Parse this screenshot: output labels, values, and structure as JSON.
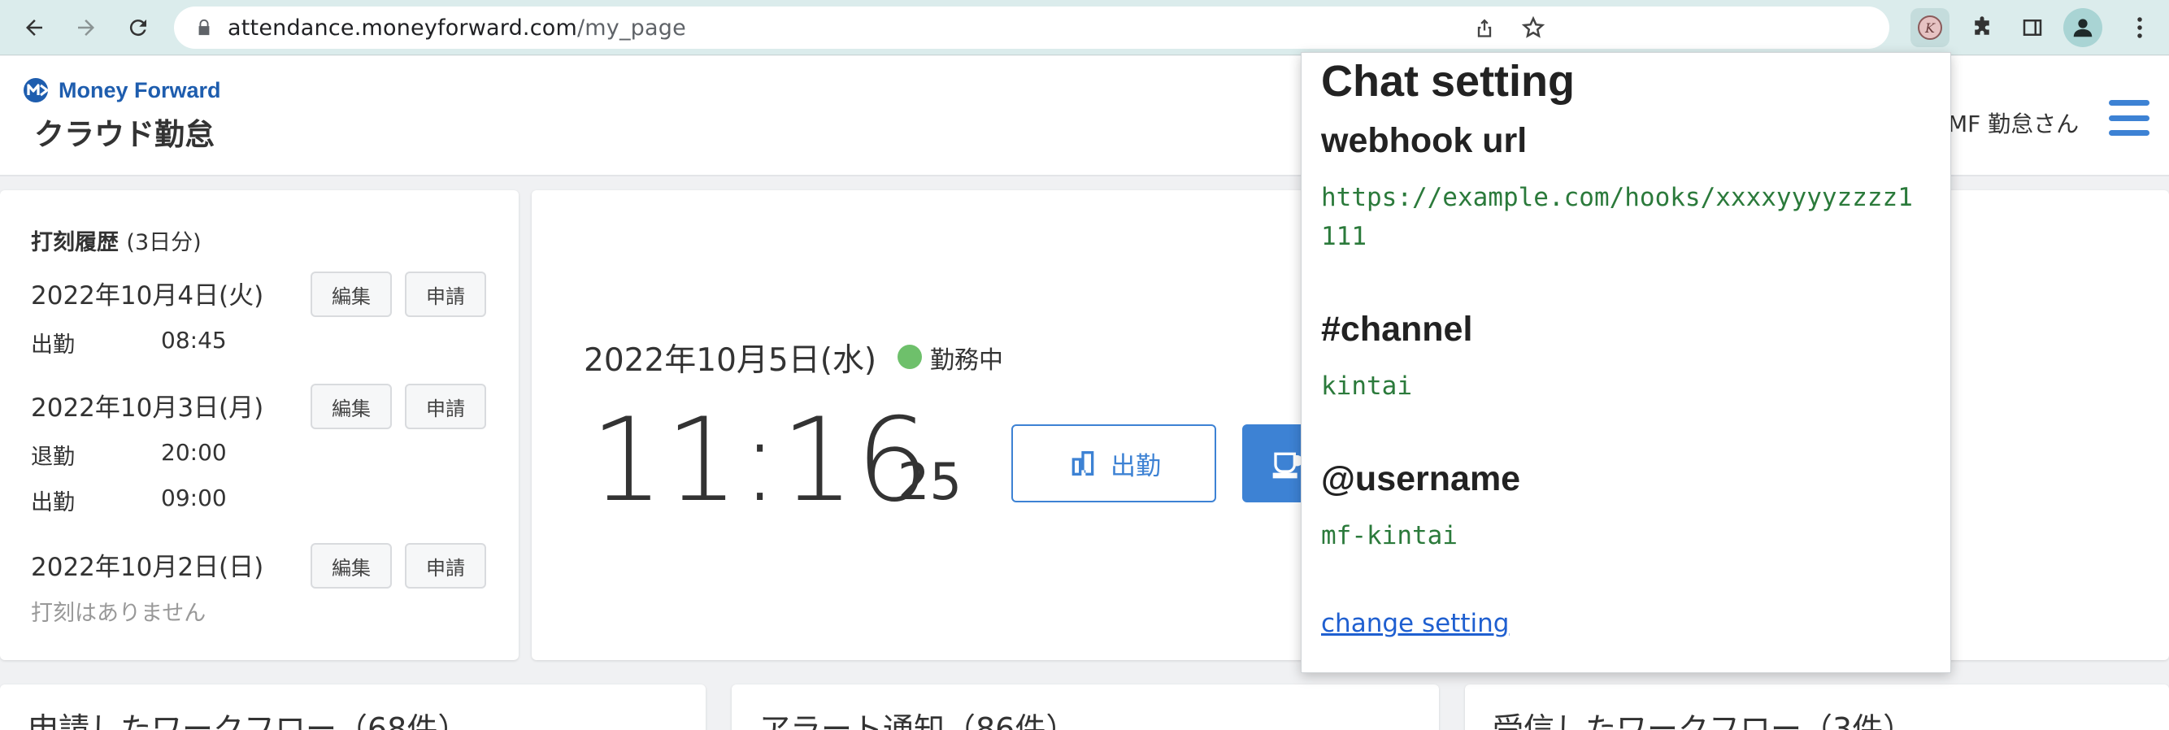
{
  "browser": {
    "url_host": "attendance.moneyforward.com",
    "url_path": "/my_page"
  },
  "header": {
    "logo_text": "Money Forward",
    "app_name": "クラウド勤怠",
    "user_name": "MF 勤怠さん"
  },
  "history": {
    "title": "打刻履歴",
    "subtitle": "(3日分)",
    "edit_label": "編集",
    "request_label": "申請",
    "days": [
      {
        "date": "2022年10月4日(火)",
        "records": [
          {
            "type": "出勤",
            "time": "08:45"
          }
        ]
      },
      {
        "date": "2022年10月3日(月)",
        "records": [
          {
            "type": "退勤",
            "time": "20:00"
          },
          {
            "type": "出勤",
            "time": "09:00"
          }
        ]
      },
      {
        "date": "2022年10月2日(日)",
        "no_records": "打刻はありません"
      }
    ]
  },
  "clock": {
    "date": "2022年10月5日(水)",
    "status": "勤務中",
    "status_color": "#6ec06b",
    "time": "11:16",
    "seconds": "25",
    "clock_in_label": "出勤"
  },
  "bottom_cards": [
    {
      "title": "申請したワークフロー（68件）"
    },
    {
      "title": "アラート通知（86件）"
    },
    {
      "title": "受信したワークフロー（3件）"
    }
  ],
  "popup": {
    "title": "Chat setting",
    "webhook_label": "webhook url",
    "webhook_value": "https://example.com/hooks/xxxxyyyyzzzz1111",
    "channel_label": "#channel",
    "channel_value": "kintai",
    "username_label": "@username",
    "username_value": "mf-kintai",
    "change_link": "change setting"
  },
  "colors": {
    "accent": "#3d82d4",
    "value_green": "#2b7a3b",
    "chrome_bg": "#dbecec"
  }
}
